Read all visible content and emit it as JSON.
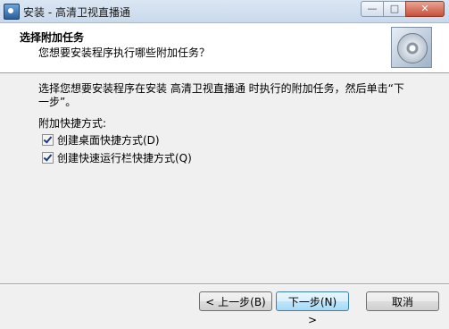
{
  "window": {
    "title": "安装 - 高清卫视直播通",
    "min_glyph": "—",
    "max_glyph": "□",
    "close_glyph": "✕"
  },
  "header": {
    "title": "选择附加任务",
    "subtitle": "您想要安装程序执行哪些附加任务？",
    "icon": "cd-installer-icon"
  },
  "body": {
    "description": "选择您想要安装程序在安装 高清卫视直播通 时执行的附加任务，然后单击“下一步”。",
    "shortcut_label": "附加快捷方式:",
    "tasks": [
      {
        "label": "创建桌面快捷方式(D)",
        "checked": true
      },
      {
        "label": "创建快速运行栏快捷方式(Q)",
        "checked": true
      }
    ]
  },
  "buttons": {
    "back": "< 上一步(B)",
    "next": "下一步(N) >",
    "cancel": "取消"
  }
}
